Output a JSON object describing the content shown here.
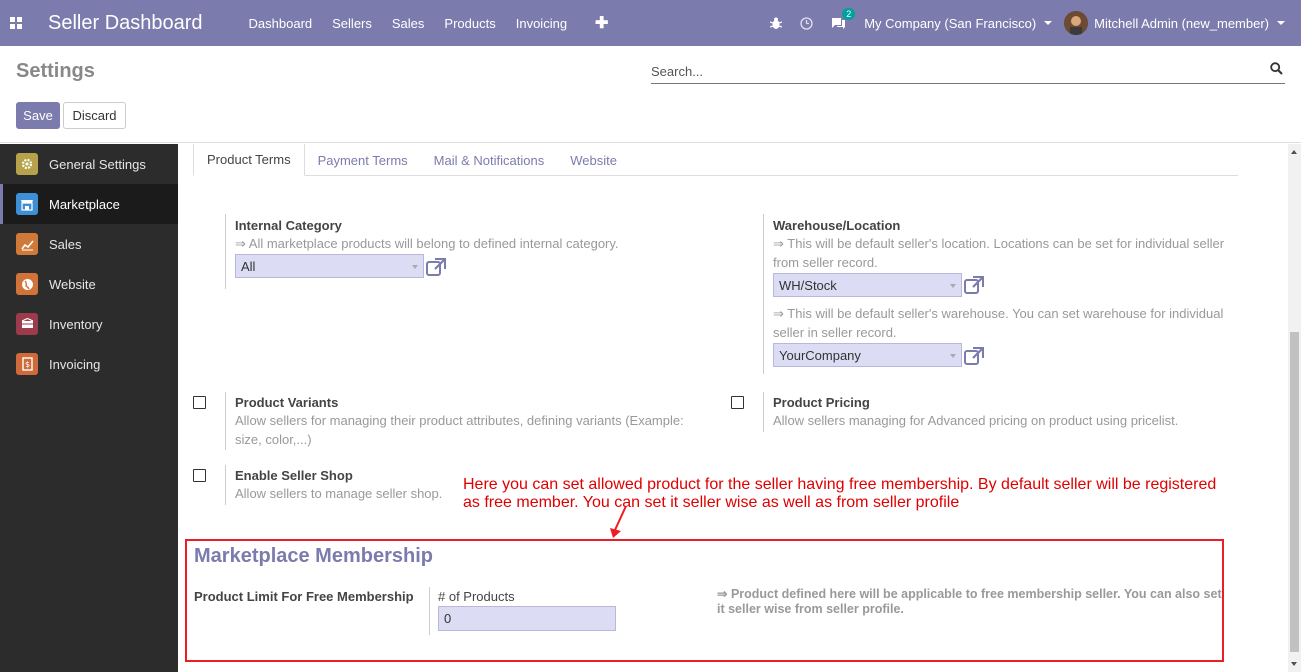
{
  "navbar": {
    "brand": "Seller Dashboard",
    "menu": [
      "Dashboard",
      "Sellers",
      "Sales",
      "Products",
      "Invoicing"
    ],
    "plus": "✚",
    "chat_badge": "2",
    "company": "My Company (San Francisco)",
    "user": "Mitchell Admin (new_member)"
  },
  "control": {
    "title": "Settings",
    "search_placeholder": "Search...",
    "save_label": "Save",
    "discard_label": "Discard"
  },
  "sidebar": {
    "items": [
      {
        "label": "General Settings",
        "color": "#b5a24a"
      },
      {
        "label": "Marketplace",
        "color": "#3f8fd6"
      },
      {
        "label": "Sales",
        "color": "#d07a3a"
      },
      {
        "label": "Website",
        "color": "#d0743a"
      },
      {
        "label": "Inventory",
        "color": "#9b3b4b"
      },
      {
        "label": "Invoicing",
        "color": "#cf6b3a"
      }
    ]
  },
  "tabs": [
    "Product Terms",
    "Payment Terms",
    "Mail & Notifications",
    "Website"
  ],
  "settings": {
    "internal_category": {
      "title": "Internal Category",
      "help": "⇒ All marketplace products will belong to defined internal category.",
      "value": "All"
    },
    "warehouse": {
      "title": "Warehouse/Location",
      "help1": "⇒ This will be default seller's location. Locations can be set for individual seller from seller record.",
      "value1": "WH/Stock",
      "help2": "⇒ This will be default seller's warehouse. You can set warehouse for individual seller in seller record.",
      "value2": "YourCompany"
    },
    "variants": {
      "title": "Product Variants",
      "help": "Allow sellers for managing their product attributes, defining variants (Example: size, color,...)"
    },
    "pricing": {
      "title": "Product Pricing",
      "help": "Allow sellers managing for Advanced pricing on product using pricelist."
    },
    "seller_shop": {
      "title": "Enable Seller Shop",
      "help": "Allow sellers to manage seller shop."
    }
  },
  "annotation": "Here you can set allowed product for the seller having free membership. By default seller will be registered as free member. You can set it seller wise as well as from seller profile",
  "membership": {
    "title": "Marketplace Membership",
    "label": "Product Limit For Free Membership",
    "field_label": "# of Products",
    "value": "0",
    "help": "⇒ Product defined here will be applicable to free membership seller. You can also set it seller wise from seller profile."
  },
  "colors": {
    "primary": "#7c7bad",
    "annotation_red": "#ee1c24"
  }
}
